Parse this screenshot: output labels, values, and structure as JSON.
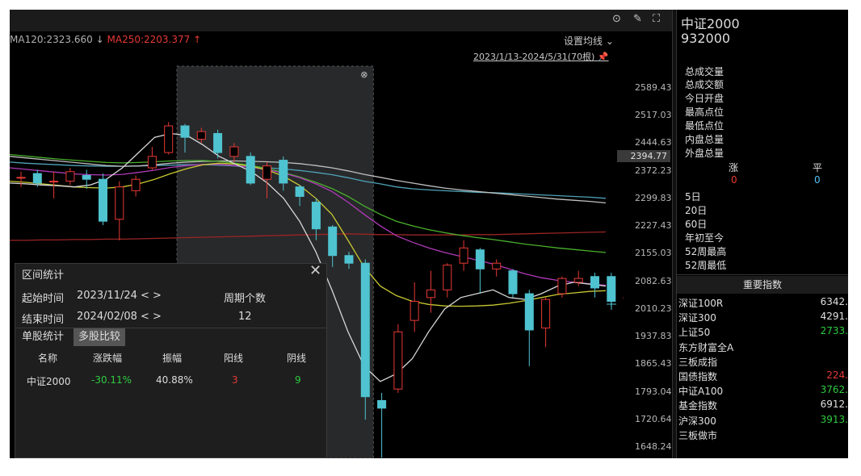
{
  "ma_labels": {
    "ma120": "MA120:2323.660",
    "ma120_arrow": "↓",
    "ma250": "MA250:2203.377",
    "ma250_arrow": "↑"
  },
  "toolbar": {
    "set_ma": "设置均线 ⌄",
    "date_range": "2023/1/13-2024/5/31(70根)"
  },
  "y_axis": [
    "2589.43",
    "2517.03",
    "2444.63",
    "2372.23",
    "2299.83",
    "2227.43",
    "2155.03",
    "2082.63",
    "2010.23",
    "1937.83",
    "1865.43",
    "1793.04",
    "1720.64",
    "1648.24"
  ],
  "current_price": "2394.77",
  "quote": {
    "name": "中证2000",
    "code": "932000",
    "fields": [
      "总成交量",
      "总成交额",
      "今日开盘",
      "最高点位",
      "最低点位",
      "内盘总量",
      "外盘总量"
    ],
    "rise_label": "涨",
    "flat_label": "平",
    "rise_count": "0",
    "flat_count": "0",
    "periods": [
      "5日",
      "20日",
      "60日",
      "年初至今",
      "52周最高",
      "52周最低"
    ]
  },
  "index_header": "重要指数",
  "indices": [
    {
      "name": "深证100R",
      "value": "6342.",
      "color": "#e0e0e0"
    },
    {
      "name": "深证300",
      "value": "4291.",
      "color": "#e0e0e0"
    },
    {
      "name": "上证50",
      "value": "2733.",
      "color": "#2ecc40"
    },
    {
      "name": "东方财富全A",
      "value": "",
      "color": "#e0e0e0"
    },
    {
      "name": "三板成指",
      "value": "",
      "color": "#e0e0e0"
    },
    {
      "name": "国债指数",
      "value": "224.",
      "color": "#e53935"
    },
    {
      "name": "中证A100",
      "value": "3762.",
      "color": "#2ecc40"
    },
    {
      "name": "基金指数",
      "value": "6912.",
      "color": "#e0e0e0"
    },
    {
      "name": "沪深300",
      "value": "3913.",
      "color": "#2ecc40"
    },
    {
      "name": "三板做市",
      "value": "",
      "color": "#e0e0e0"
    }
  ],
  "interval_panel": {
    "title": "区间统计",
    "start_label": "起始时间",
    "start_value": "2023/11/24",
    "end_label": "结束时间",
    "end_value": "2024/02/08",
    "nav": "< >",
    "period_label": "周期个数",
    "period_count": "12",
    "tab_single": "单股统计",
    "tab_multi": "多股比较",
    "columns": [
      "名称",
      "涨跌幅",
      "振幅",
      "阳线",
      "阴线"
    ],
    "row": {
      "name": "中证2000",
      "change": "-30.11%",
      "amplitude": "40.88%",
      "up": "3",
      "down": "9"
    }
  },
  "chart_data": {
    "type": "candlestick",
    "ylim": [
      1648.24,
      2589.43
    ],
    "y_ticks": [
      2589.43,
      2517.03,
      2444.63,
      2372.23,
      2299.83,
      2227.43,
      2155.03,
      2082.63,
      2010.23,
      1937.83,
      1865.43,
      1793.04,
      1720.64,
      1648.24
    ],
    "candles": [
      {
        "o": 2355,
        "c": 2355,
        "h": 2370,
        "l": 2330
      },
      {
        "o": 2365,
        "c": 2340,
        "h": 2375,
        "l": 2330
      },
      {
        "o": 2345,
        "c": 2345,
        "h": 2370,
        "l": 2300
      },
      {
        "o": 2345,
        "c": 2370,
        "h": 2380,
        "l": 2335
      },
      {
        "o": 2360,
        "c": 2350,
        "h": 2375,
        "l": 2325
      },
      {
        "o": 2350,
        "c": 2240,
        "h": 2365,
        "l": 2230
      },
      {
        "o": 2245,
        "c": 2330,
        "h": 2345,
        "l": 2190
      },
      {
        "o": 2320,
        "c": 2350,
        "h": 2360,
        "l": 2305
      },
      {
        "o": 2380,
        "c": 2410,
        "h": 2435,
        "l": 2375
      },
      {
        "o": 2420,
        "c": 2490,
        "h": 2500,
        "l": 2415
      },
      {
        "o": 2490,
        "c": 2460,
        "h": 2495,
        "l": 2420
      },
      {
        "o": 2455,
        "c": 2475,
        "h": 2485,
        "l": 2445
      },
      {
        "o": 2470,
        "c": 2420,
        "h": 2480,
        "l": 2405
      },
      {
        "o": 2410,
        "c": 2435,
        "h": 2445,
        "l": 2395
      },
      {
        "o": 2410,
        "c": 2340,
        "h": 2420,
        "l": 2335
      },
      {
        "o": 2350,
        "c": 2385,
        "h": 2395,
        "l": 2300
      },
      {
        "o": 2400,
        "c": 2340,
        "h": 2410,
        "l": 2320
      },
      {
        "o": 2330,
        "c": 2305,
        "h": 2335,
        "l": 2280
      },
      {
        "o": 2290,
        "c": 2220,
        "h": 2300,
        "l": 2190
      },
      {
        "o": 2225,
        "c": 2150,
        "h": 2230,
        "l": 2120
      },
      {
        "o": 2150,
        "c": 2130,
        "h": 2160,
        "l": 2115
      },
      {
        "o": 2130,
        "c": 1780,
        "h": 2140,
        "l": 1720
      },
      {
        "o": 1770,
        "c": 1750,
        "h": 1790,
        "l": 1620
      },
      {
        "o": 1800,
        "c": 1950,
        "h": 1970,
        "l": 1790
      },
      {
        "o": 1980,
        "c": 2030,
        "h": 2080,
        "l": 1950
      },
      {
        "o": 2040,
        "c": 2060,
        "h": 2110,
        "l": 2000
      },
      {
        "o": 2060,
        "c": 2125,
        "h": 2130,
        "l": 2040
      },
      {
        "o": 2130,
        "c": 2170,
        "h": 2190,
        "l": 2110
      },
      {
        "o": 2165,
        "c": 2115,
        "h": 2170,
        "l": 2050
      },
      {
        "o": 2115,
        "c": 2130,
        "h": 2140,
        "l": 2095
      },
      {
        "o": 2110,
        "c": 2050,
        "h": 2115,
        "l": 2040
      },
      {
        "o": 2050,
        "c": 1955,
        "h": 2060,
        "l": 1860
      },
      {
        "o": 1960,
        "c": 2035,
        "h": 2040,
        "l": 1910
      },
      {
        "o": 2050,
        "c": 2090,
        "h": 2095,
        "l": 2040
      },
      {
        "o": 2080,
        "c": 2090,
        "h": 2110,
        "l": 2070
      },
      {
        "o": 2095,
        "c": 2065,
        "h": 2105,
        "l": 2040
      },
      {
        "o": 2095,
        "c": 2030,
        "h": 2105,
        "l": 2015
      },
      {
        "o": 2040,
        "c": 2040,
        "h": 2050,
        "l": 2010
      }
    ],
    "ma_lines": [
      {
        "color": "#4fa3b8",
        "values": [
          2395,
          2392,
          2390,
          2388,
          2386,
          2385,
          2384,
          2384,
          2385,
          2386,
          2387,
          2388,
          2388,
          2387,
          2385,
          2382,
          2380,
          2377,
          2373,
          2368,
          2362,
          2354,
          2345,
          2338,
          2330,
          2325,
          2322,
          2320,
          2318,
          2316,
          2315,
          2313,
          2311,
          2309,
          2307,
          2305,
          2303,
          2300
        ]
      },
      {
        "color": "#c0c0c0",
        "values": [
          2410,
          2406,
          2402,
          2398,
          2394,
          2390,
          2386,
          2384,
          2385,
          2388,
          2392,
          2395,
          2397,
          2398,
          2398,
          2397,
          2396,
          2394,
          2391,
          2386,
          2380,
          2372,
          2363,
          2355,
          2347,
          2340,
          2333,
          2327,
          2322,
          2318,
          2314,
          2310,
          2306,
          2302,
          2298,
          2295,
          2292,
          2288
        ]
      },
      {
        "color": "#9a2424",
        "values": [
          2190,
          2190,
          2191,
          2191,
          2192,
          2192,
          2193,
          2193,
          2194,
          2195,
          2196,
          2197,
          2198,
          2199,
          2200,
          2201,
          2202,
          2203,
          2204,
          2205,
          2206,
          2207,
          2206,
          2205,
          2205,
          2204,
          2204,
          2204,
          2204,
          2205,
          2205,
          2206,
          2207,
          2208,
          2209,
          2210,
          2211,
          2212
        ]
      },
      {
        "color": "#4ab02c",
        "values": [
          2415,
          2411,
          2407,
          2403,
          2400,
          2397,
          2394,
          2393,
          2394,
          2396,
          2398,
          2399,
          2399,
          2397,
          2392,
          2386,
          2378,
          2368,
          2356,
          2342,
          2326,
          2305,
          2280,
          2258,
          2240,
          2228,
          2218,
          2210,
          2203,
          2197,
          2192,
          2186,
          2180,
          2175,
          2170,
          2166,
          2162,
          2158
        ]
      },
      {
        "color": "#b03ab8",
        "values": [
          2380,
          2376,
          2372,
          2368,
          2364,
          2362,
          2361,
          2363,
          2368,
          2374,
          2381,
          2386,
          2389,
          2389,
          2386,
          2381,
          2375,
          2366,
          2354,
          2338,
          2318,
          2290,
          2258,
          2228,
          2202,
          2185,
          2170,
          2158,
          2148,
          2138,
          2128,
          2115,
          2102,
          2092,
          2085,
          2080,
          2076,
          2072
        ]
      },
      {
        "color": "#c8c832",
        "values": [
          2345,
          2342,
          2338,
          2334,
          2330,
          2328,
          2327,
          2330,
          2338,
          2350,
          2365,
          2378,
          2388,
          2392,
          2390,
          2384,
          2374,
          2358,
          2334,
          2300,
          2258,
          2190,
          2120,
          2070,
          2045,
          2030,
          2022,
          2018,
          2017,
          2018,
          2020,
          2025,
          2032,
          2040,
          2048,
          2052,
          2056,
          2058
        ]
      },
      {
        "color": "#d8d8d8",
        "values": [
          2340,
          2338,
          2335,
          2333,
          2330,
          2335,
          2350,
          2380,
          2420,
          2460,
          2470,
          2465,
          2440,
          2410,
          2390,
          2370,
          2340,
          2300,
          2240,
          2160,
          2060,
          1950,
          1860,
          1820,
          1840,
          1880,
          1950,
          2010,
          2040,
          2050,
          2060,
          2040,
          2035,
          2050,
          2070,
          2080,
          2075,
          2070
        ]
      }
    ],
    "highlight_range": [
      10,
      21
    ]
  }
}
